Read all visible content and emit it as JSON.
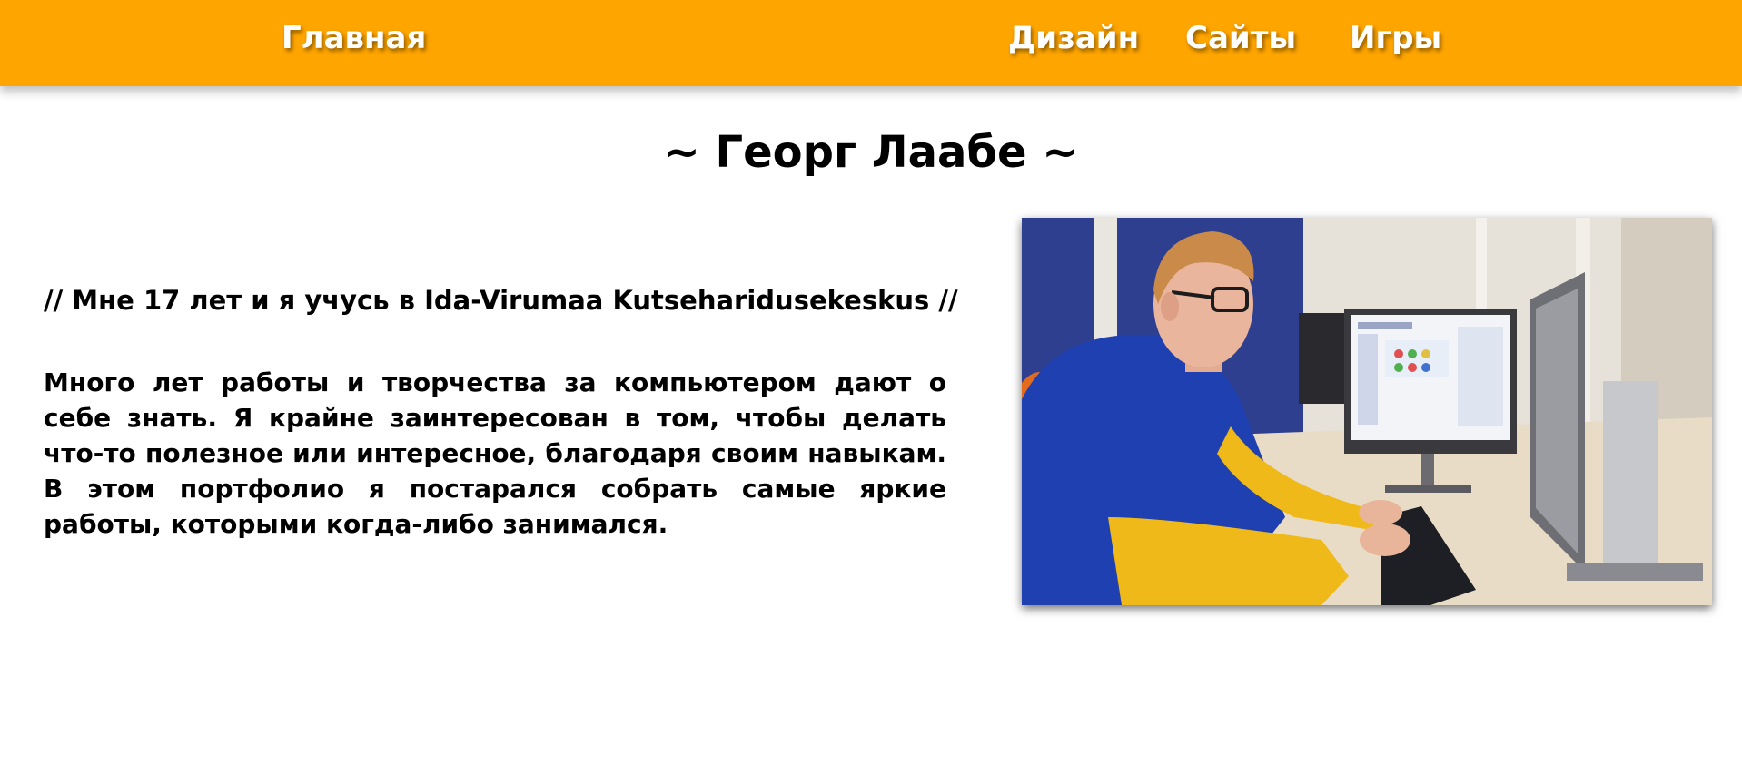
{
  "nav": {
    "home_label": "Главная",
    "design_label": "Дизайн",
    "sites_label": "Сайты",
    "games_label": "Игры"
  },
  "header": {
    "title": "~ Георг Лаабе ~"
  },
  "main": {
    "subtitle": "// Мне 17 лет и я учусь в Ida-Virumaa Kutseharidusekeskus //",
    "bio": "Много лет работы и творчества за компьютером дают о себе знать. Я крайне заинтересован в том, чтобы делать что-то полезное или интересное, благодаря своим навыкам. В этом портфолио я постарался собрать самые яркие работы, которыми когда-либо занимался."
  },
  "colors": {
    "nav_background": "#FFA500",
    "nav_text": "#FFFFFF",
    "body_text": "#000000",
    "page_background": "#FFFFFF"
  }
}
